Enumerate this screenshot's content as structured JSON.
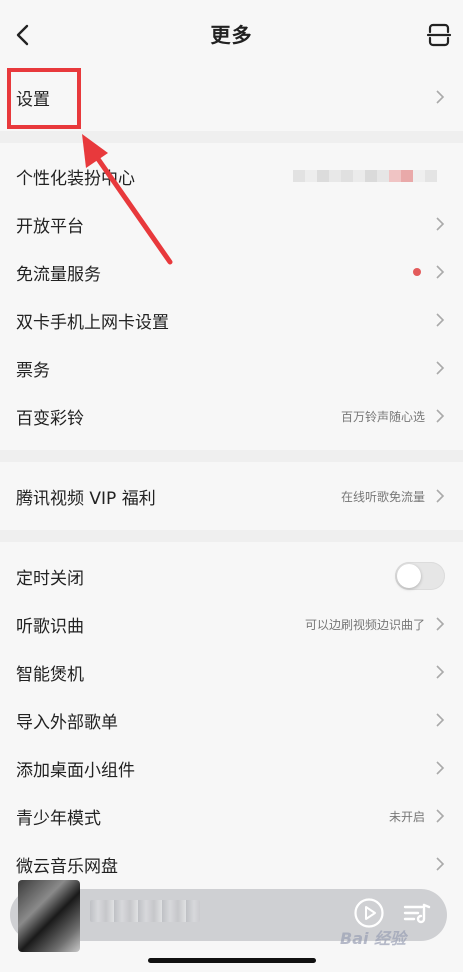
{
  "header": {
    "title": "更多",
    "back_icon": "chevron-left-icon",
    "scan_icon": "scan-icon"
  },
  "groups": [
    {
      "items": [
        {
          "label": "设置",
          "type": "chevron"
        }
      ]
    },
    {
      "items": [
        {
          "label": "个性化装扮中心",
          "type": "blurred"
        },
        {
          "label": "开放平台",
          "type": "chevron"
        },
        {
          "label": "免流量服务",
          "type": "dot-chevron"
        },
        {
          "label": "双卡手机上网卡设置",
          "type": "chevron"
        },
        {
          "label": "票务",
          "type": "chevron"
        },
        {
          "label": "百变彩铃",
          "sub": "百万铃声随心选",
          "type": "sub-chevron"
        }
      ]
    },
    {
      "items": [
        {
          "label": "腾讯视频 VIP 福利",
          "sub": "在线听歌免流量",
          "type": "sub-chevron"
        }
      ]
    },
    {
      "items": [
        {
          "label": "定时关闭",
          "type": "toggle",
          "toggle_on": false
        },
        {
          "label": "听歌识曲",
          "sub": "可以边刷视频边识曲了",
          "type": "sub-chevron"
        },
        {
          "label": "智能煲机",
          "type": "chevron"
        },
        {
          "label": "导入外部歌单",
          "type": "chevron"
        },
        {
          "label": "添加桌面小组件",
          "type": "chevron"
        },
        {
          "label": "青少年模式",
          "sub": "未开启",
          "type": "sub-chevron"
        },
        {
          "label": "微云音乐网盘",
          "type": "chevron"
        }
      ]
    }
  ],
  "player": {
    "play_icon": "play-circle-icon",
    "playlist_icon": "playlist-icon"
  },
  "watermark": "Bai 经验",
  "colors": {
    "accent_red": "#e8393c",
    "dot_red": "#e35b5b",
    "background": "#f7f7f7"
  }
}
